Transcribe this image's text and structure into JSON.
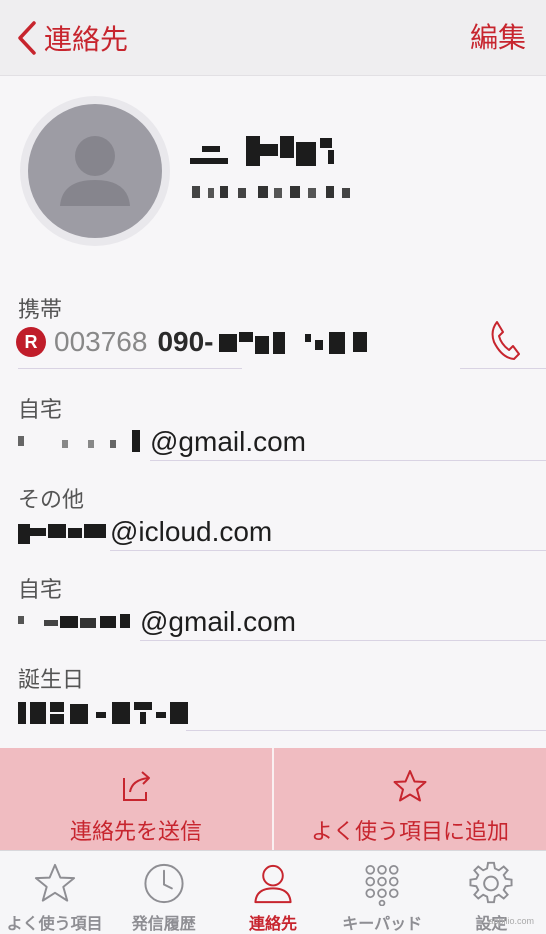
{
  "nav": {
    "back_label": "連絡先",
    "edit_label": "編集"
  },
  "fields": {
    "mobile": {
      "label": "携帯",
      "badge": "R",
      "prefix": "003768",
      "number_visible": "090-"
    },
    "home_email_1": {
      "label": "自宅",
      "domain": "@gmail.com"
    },
    "other_email": {
      "label": "その他",
      "domain": "@icloud.com"
    },
    "home_email_2": {
      "label": "自宅",
      "domain": "@gmail.com"
    },
    "birthday": {
      "label": "誕生日"
    }
  },
  "actions": {
    "send_contact": "連絡先を送信",
    "add_favorite": "よく使う項目に追加"
  },
  "tabs": [
    {
      "label": "よく使う項目",
      "icon": "star-icon",
      "active": false
    },
    {
      "label": "発信履歴",
      "icon": "clock-icon",
      "active": false
    },
    {
      "label": "連絡先",
      "icon": "person-icon",
      "active": true
    },
    {
      "label": "キーパッド",
      "icon": "keypad-icon",
      "active": false
    },
    {
      "label": "設定",
      "icon": "gear-icon",
      "active": false
    }
  ],
  "watermark": "appllio.com",
  "colors": {
    "accent": "#c7252e",
    "action_bar": "#f0bcc1",
    "avatar": "#9d9ca4"
  }
}
